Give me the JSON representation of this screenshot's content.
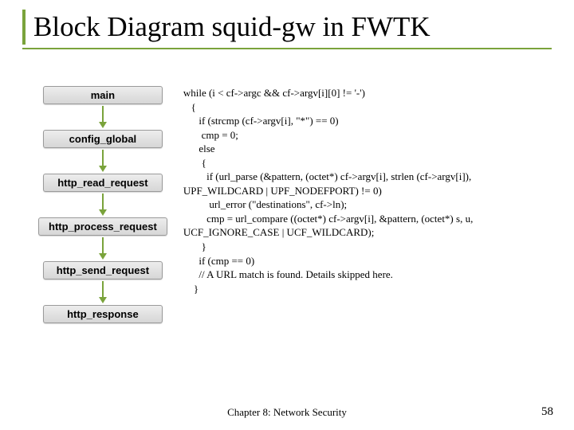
{
  "title": "Block Diagram squid-gw in FWTK",
  "flow": {
    "nodes": [
      {
        "label": "main"
      },
      {
        "label": "config_global"
      },
      {
        "label": "http_read_request"
      },
      {
        "label": "http_process_request"
      },
      {
        "label": "http_send_request"
      },
      {
        "label": "http_response"
      }
    ]
  },
  "code": "while (i < cf->argc && cf->argv[i][0] != '-')\n   {\n      if (strcmp (cf->argv[i], \"*\") == 0)\n       cmp = 0;\n      else\n       {\n         if (url_parse (&pattern, (octet*) cf->argv[i], strlen (cf->argv[i]),\nUPF_WILDCARD | UPF_NODEFPORT) != 0)\n          url_error (\"destinations\", cf->ln);\n         cmp = url_compare ((octet*) cf->argv[i], &pattern, (octet*) s, u,\nUCF_IGNORE_CASE | UCF_WILDCARD);\n       }\n      if (cmp == 0)\n      // A URL match is found. Details skipped here.\n    }",
  "footer": "Chapter 8: Network Security",
  "page_number": "58"
}
